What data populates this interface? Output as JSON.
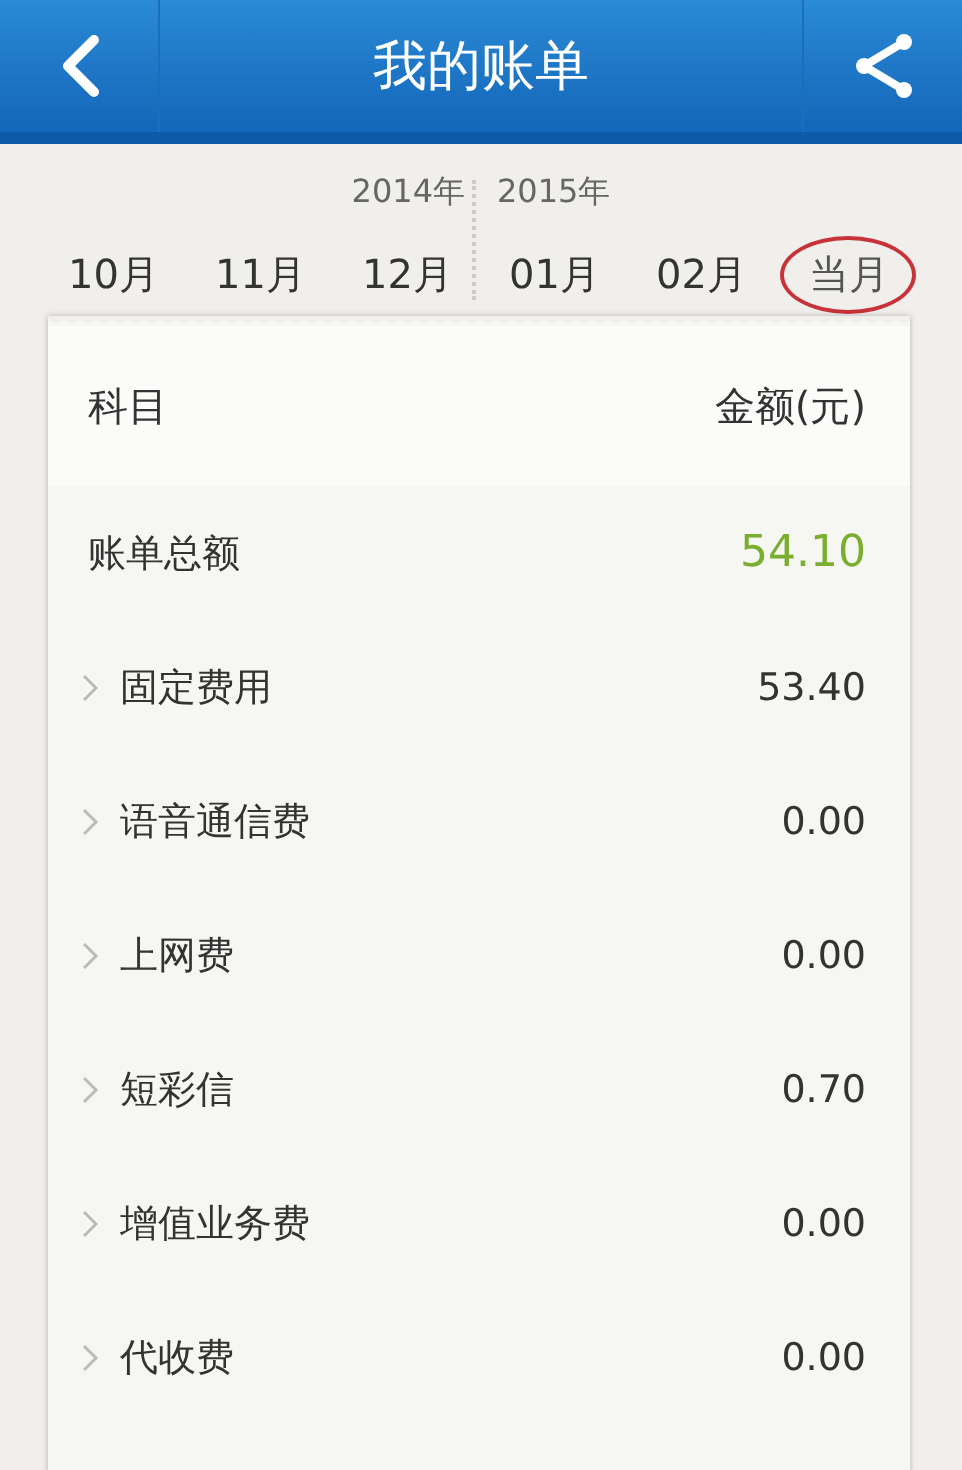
{
  "header": {
    "title": "我的账单"
  },
  "years": [
    "2014年",
    "2015年"
  ],
  "months": [
    {
      "label": "10月",
      "selected": false
    },
    {
      "label": "11月",
      "selected": false
    },
    {
      "label": "12月",
      "selected": false
    },
    {
      "label": "01月",
      "selected": false
    },
    {
      "label": "02月",
      "selected": false
    },
    {
      "label": "当月",
      "selected": true
    }
  ],
  "bill": {
    "columns": [
      "科目",
      "金额(元)"
    ],
    "rows": [
      {
        "kind": "total",
        "name": "账单总额",
        "amount": "54.10"
      },
      {
        "kind": "category",
        "name": "固定费用",
        "amount": "53.40"
      },
      {
        "kind": "category",
        "name": "语音通信费",
        "amount": "0.00"
      },
      {
        "kind": "category",
        "name": "上网费",
        "amount": "0.00"
      },
      {
        "kind": "category",
        "name": "短彩信",
        "amount": "0.70"
      },
      {
        "kind": "category",
        "name": "增值业务费",
        "amount": "0.00"
      },
      {
        "kind": "category",
        "name": "代收费",
        "amount": "0.00"
      }
    ]
  }
}
